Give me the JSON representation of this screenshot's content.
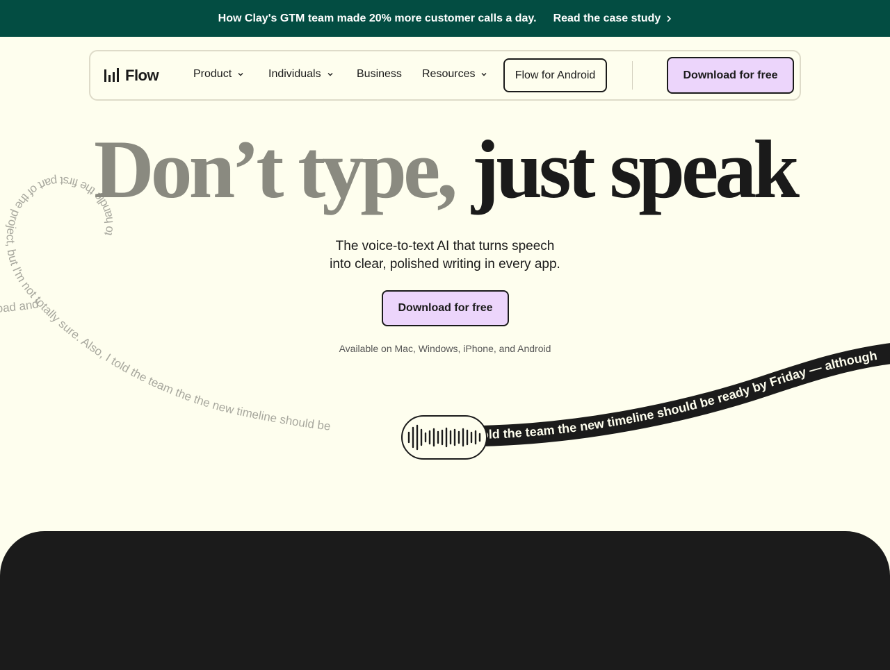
{
  "banner": {
    "message": "How Clay's GTM team made 20% more customer calls a day.",
    "link_label": "Read the case study",
    "link_icon": "chevron-right-icon",
    "background": "#034d42"
  },
  "nav": {
    "logo_text": "Flow",
    "logo_icon": "bars-waveform-icon",
    "items": [
      {
        "label": "Product",
        "has_dropdown": true
      },
      {
        "label": "Individuals",
        "has_dropdown": true
      },
      {
        "label": "Business",
        "has_dropdown": false
      },
      {
        "label": "Resources",
        "has_dropdown": true
      }
    ],
    "android_label": "Flow for Android",
    "download_label": "Download for free"
  },
  "hero": {
    "title_muted": "Don’t type,",
    "title_dark": "just speak",
    "subtitle_line1": "The voice-to-text AI that turns speech",
    "subtitle_line2": "into clear, polished writing in every app.",
    "download_label": "Download for free",
    "availability": "Available on Mac, Windows, iPhone, and Android"
  },
  "speech": {
    "raw_text": "to handle the first part of the project, but I'm not totally sure. Also, I told the team the the new timeline should be",
    "raw_text_left": "oad and I think their going",
    "polished_text": "old the team the new timeline should be ready by Friday — although",
    "mic_icon": "audio-waveform-icon"
  },
  "colors": {
    "page_bg": "#fefeee",
    "accent": "#ecd5fb",
    "dark": "#1a1a1a",
    "muted_title": "#8a8a80"
  }
}
